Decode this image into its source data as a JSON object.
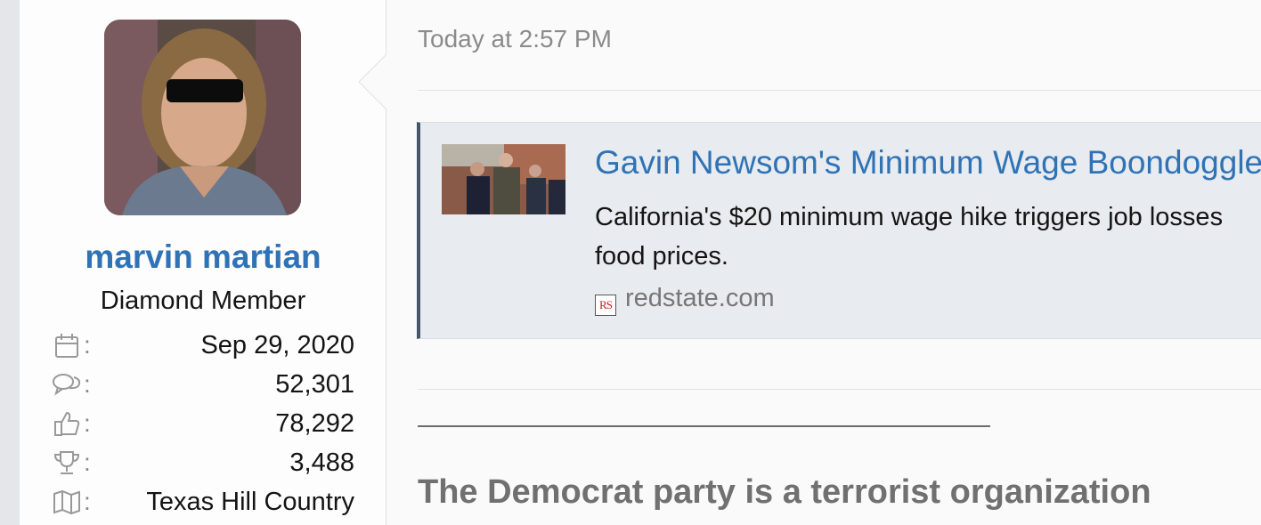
{
  "user": {
    "name": "marvin martian",
    "title": "Diamond Member",
    "stats": [
      {
        "icon": "calendar-icon",
        "value": "Sep 29, 2020"
      },
      {
        "icon": "messages-icon",
        "value": "52,301"
      },
      {
        "icon": "thumbs-up-icon",
        "value": "78,292"
      },
      {
        "icon": "trophy-icon",
        "value": "3,488"
      },
      {
        "icon": "map-icon",
        "value": "Texas Hill Country"
      }
    ],
    "colon": ":"
  },
  "post": {
    "timestamp": "Today at 2:57 PM",
    "embed": {
      "title": "Gavin Newsom's Minimum Wage Boondoggle",
      "desc_line1": "California's $20 minimum wage hike triggers job losses",
      "desc_line2": "food prices.",
      "source_icon": "RS",
      "source": "redstate.com"
    },
    "signature": "The Democrat party is a terrorist organization"
  },
  "colors": {
    "link": "#2f73b6",
    "embed_bg": "#e8ebef",
    "embed_border": "#47556a"
  }
}
